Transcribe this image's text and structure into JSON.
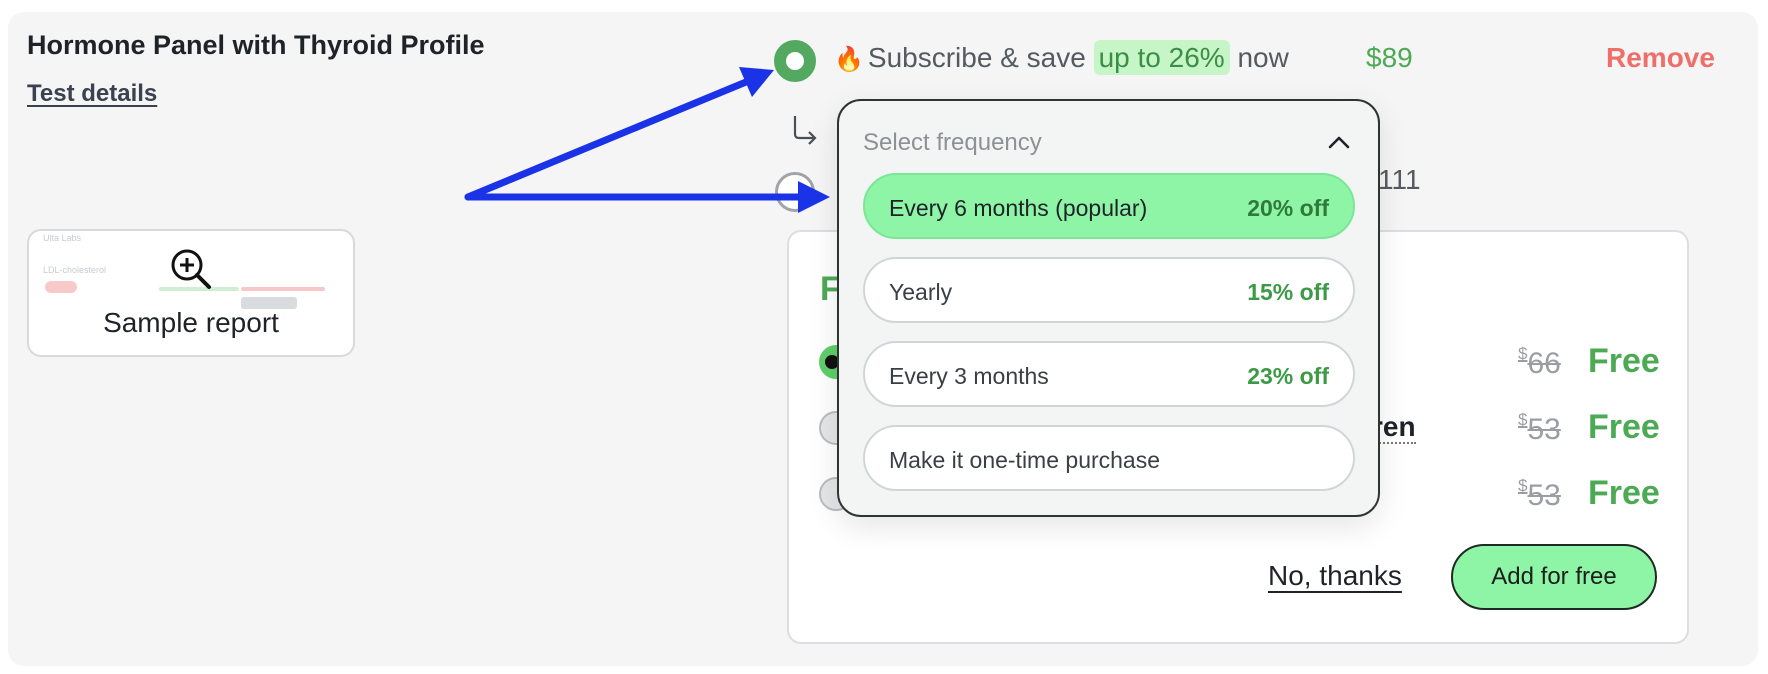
{
  "product": {
    "title": "Hormone Panel with Thyroid Profile",
    "test_details_link": "Test details",
    "sample_report_label": "Sample report"
  },
  "subscription": {
    "emoji": "🔥",
    "prefix": "Subscribe & save ",
    "highlight": "up to 26%",
    "suffix": " now",
    "price": "$89",
    "remove_label": "Remove",
    "one_time_price_partial": "111"
  },
  "dropdown": {
    "header": "Select frequency",
    "options": [
      {
        "label": "Every 6 months (popular)",
        "discount": "20% off",
        "selected": true
      },
      {
        "label": "Yearly",
        "discount": "15% off",
        "selected": false
      },
      {
        "label": "Every 3 months",
        "discount": "23% off",
        "selected": false
      },
      {
        "label": "Make it one-time purchase",
        "discount": "",
        "selected": false
      }
    ]
  },
  "offer": {
    "heading_partial": "F",
    "partial_item_text": "ren",
    "items": [
      {
        "currency": "$",
        "original": "66",
        "price": "Free"
      },
      {
        "currency": "$",
        "original": "53",
        "price": "Free"
      },
      {
        "currency": "$",
        "original": "53",
        "price": "Free"
      }
    ],
    "no_thanks_label": "No, thanks",
    "add_button_label": "Add for free"
  },
  "annotation": {
    "arrow_color": "#1a33e6"
  },
  "colors": {
    "accent_green": "#4caa55",
    "remove_red": "#ee6f6a",
    "button_green": "#8ef5a7"
  }
}
